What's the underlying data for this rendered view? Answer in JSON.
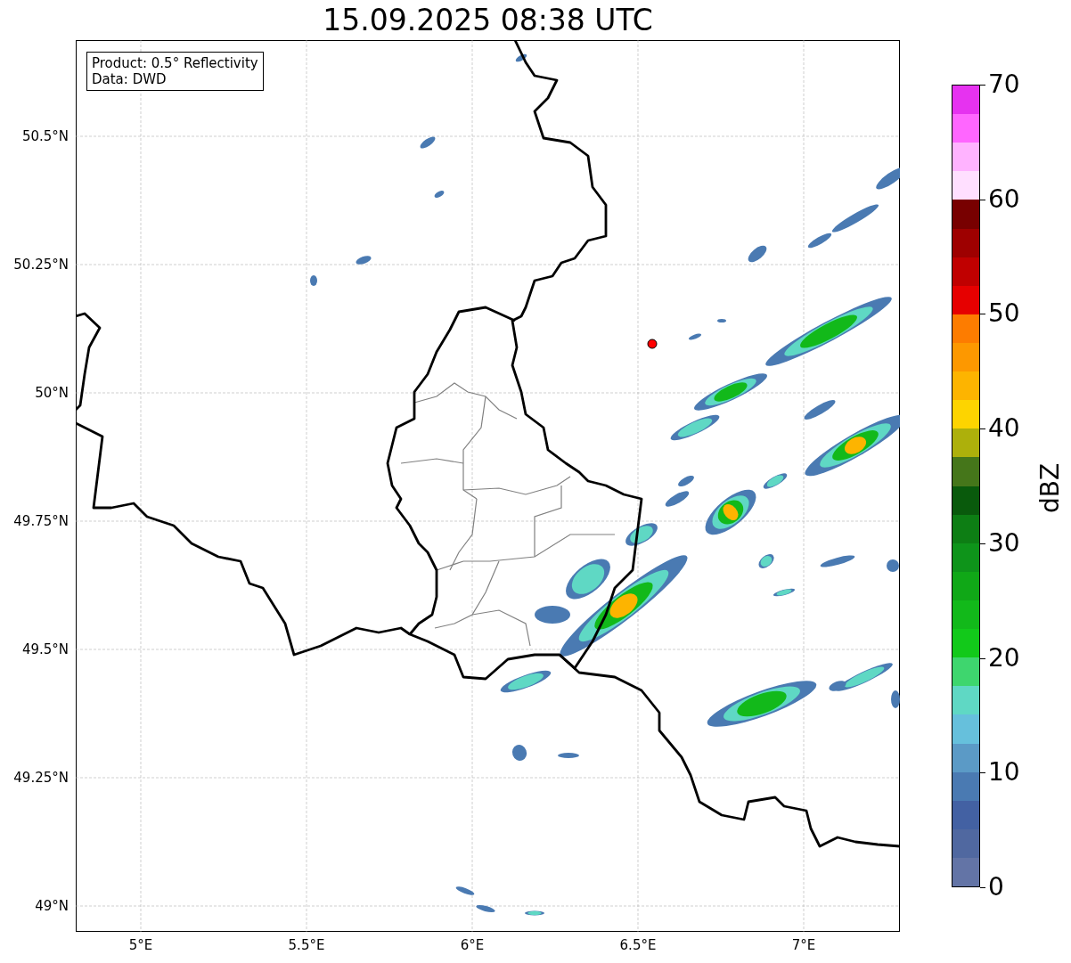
{
  "title": "15.09.2025 08:38 UTC",
  "info_box": [
    "Product: 0.5° Reflectivity",
    "Data: DWD"
  ],
  "map": {
    "yticks": [
      "50.5°N",
      "50.25°N",
      "50°N",
      "49.75°N",
      "49.5°N",
      "49.25°N",
      "49°N"
    ],
    "xticks": [
      "5°E",
      "5.5°E",
      "6°E",
      "6.5°E",
      "7°E"
    ]
  },
  "colorbar": {
    "label": "dBZ",
    "ticks": [
      "70",
      "60",
      "50",
      "40",
      "30",
      "20",
      "10",
      "0"
    ],
    "segments": [
      {
        "color": "#e632f0"
      },
      {
        "color": "#ff66ff"
      },
      {
        "color": "#ffb3ff"
      },
      {
        "color": "#ffdfff"
      },
      {
        "color": "#780000"
      },
      {
        "color": "#9e0000"
      },
      {
        "color": "#c00000"
      },
      {
        "color": "#e60000"
      },
      {
        "color": "#fd7c00"
      },
      {
        "color": "#fd9800"
      },
      {
        "color": "#fdb400"
      },
      {
        "color": "#fdd400"
      },
      {
        "color": "#adb00b"
      },
      {
        "color": "#45761a"
      },
      {
        "color": "#095a0c"
      },
      {
        "color": "#0d7e14"
      },
      {
        "color": "#0e941a"
      },
      {
        "color": "#10a817"
      },
      {
        "color": "#12b91a"
      },
      {
        "color": "#12c91a"
      },
      {
        "color": "#3ed66e"
      },
      {
        "color": "#5fd8c4"
      },
      {
        "color": "#66c0dc"
      },
      {
        "color": "#5b9ac6"
      },
      {
        "color": "#4a7ab2"
      },
      {
        "color": "#4361a3"
      },
      {
        "color": "#5068a0"
      },
      {
        "color": "#6374a6"
      }
    ]
  }
}
